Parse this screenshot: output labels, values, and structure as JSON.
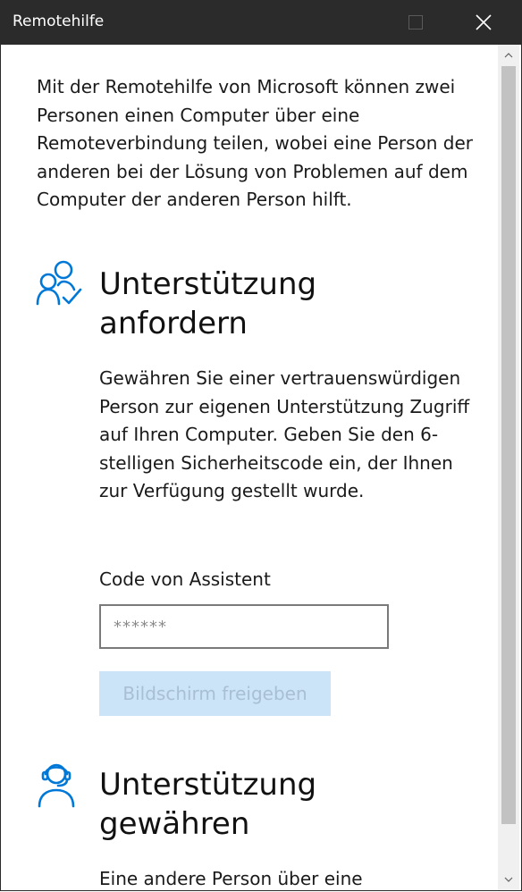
{
  "window": {
    "title": "Remotehilfe"
  },
  "intro_text": "Mit der Remotehilfe von Microsoft können zwei Personen einen Computer über eine Remoteverbindung teilen, wobei eine Person der anderen bei der Lösung von Problemen auf dem Computer der anderen Person hilft.",
  "request_section": {
    "icon": "people-check-icon",
    "title": "Unterstützung anfordern",
    "description": "Gewähren Sie einer vertrauenswürdigen Person zur eigenen Unterstützung Zugriff auf Ihren Computer. Geben Sie den 6-stelligen Sicherheitscode ein, der Ihnen zur Verfügung gestellt wurde.",
    "code_label": "Code von Assistent",
    "code_placeholder": "******",
    "code_value": "",
    "share_button_label": "Bildschirm freigeben"
  },
  "give_section": {
    "icon": "headset-person-icon",
    "title": "Unterstützung gewähren",
    "description": "Eine andere Person über eine"
  },
  "colors": {
    "titlebar": "#2b2b2b",
    "accent": "#0078d7",
    "disabled_button_bg": "#cce4f7",
    "disabled_button_text": "#a9bfd3"
  }
}
